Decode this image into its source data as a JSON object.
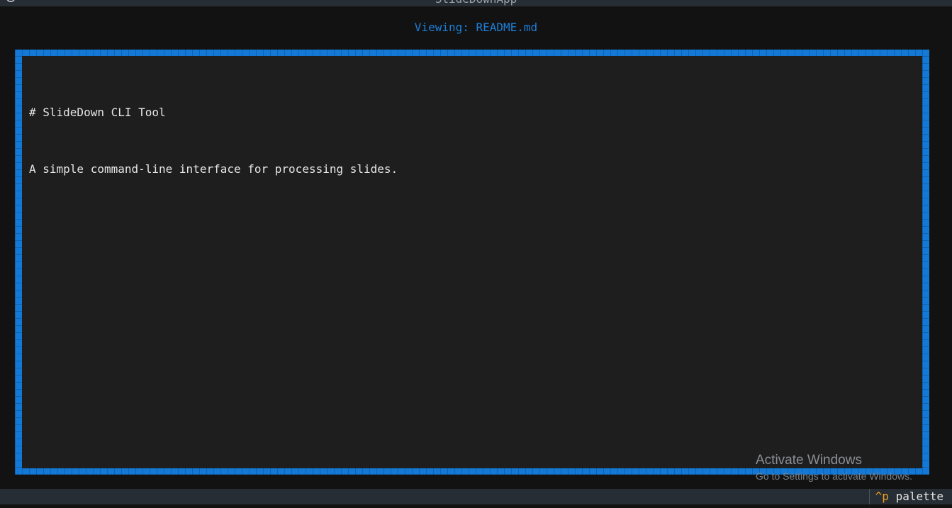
{
  "app": {
    "title": "SlideDownApp",
    "header_icon": "⭘"
  },
  "subtitle": "Viewing: README.md",
  "document": {
    "heading": "# SlideDown CLI Tool",
    "paragraph": "A simple command-line interface for processing slides."
  },
  "footer": {
    "key": "^p",
    "label": " palette"
  },
  "os_watermark": {
    "title": "Activate Windows",
    "subtitle": "Go to Settings to activate Windows."
  },
  "colors": {
    "accent": "#1479d6",
    "subtitle": "#1d7ed8",
    "key": "#f0a020",
    "background": "#121212",
    "panel": "#1e1e1e"
  }
}
